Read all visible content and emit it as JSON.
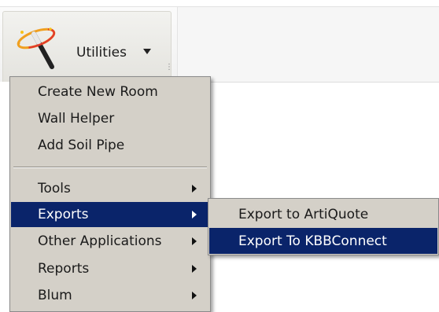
{
  "ribbon": {
    "utilities_label": "Utilities",
    "utilities_icon": "magic-wand-icon"
  },
  "menu": {
    "items": [
      {
        "label": "Create New Room",
        "has_submenu": false
      },
      {
        "label": "Wall Helper",
        "has_submenu": false
      },
      {
        "label": "Add Soil Pipe",
        "has_submenu": false
      },
      {
        "label": "Tools",
        "has_submenu": true
      },
      {
        "label": "Exports",
        "has_submenu": true,
        "selected": true
      },
      {
        "label": "Other Applications",
        "has_submenu": true
      },
      {
        "label": "Reports",
        "has_submenu": true
      },
      {
        "label": "Blum",
        "has_submenu": true
      }
    ]
  },
  "submenu": {
    "items": [
      {
        "label": "Export to ArtiQuote"
      },
      {
        "label": "Export To KBBConnect",
        "selected": true
      }
    ]
  },
  "colors": {
    "menu_bg": "#d4d0c8",
    "highlight": "#0a246a",
    "highlight_text": "#ffffff"
  }
}
